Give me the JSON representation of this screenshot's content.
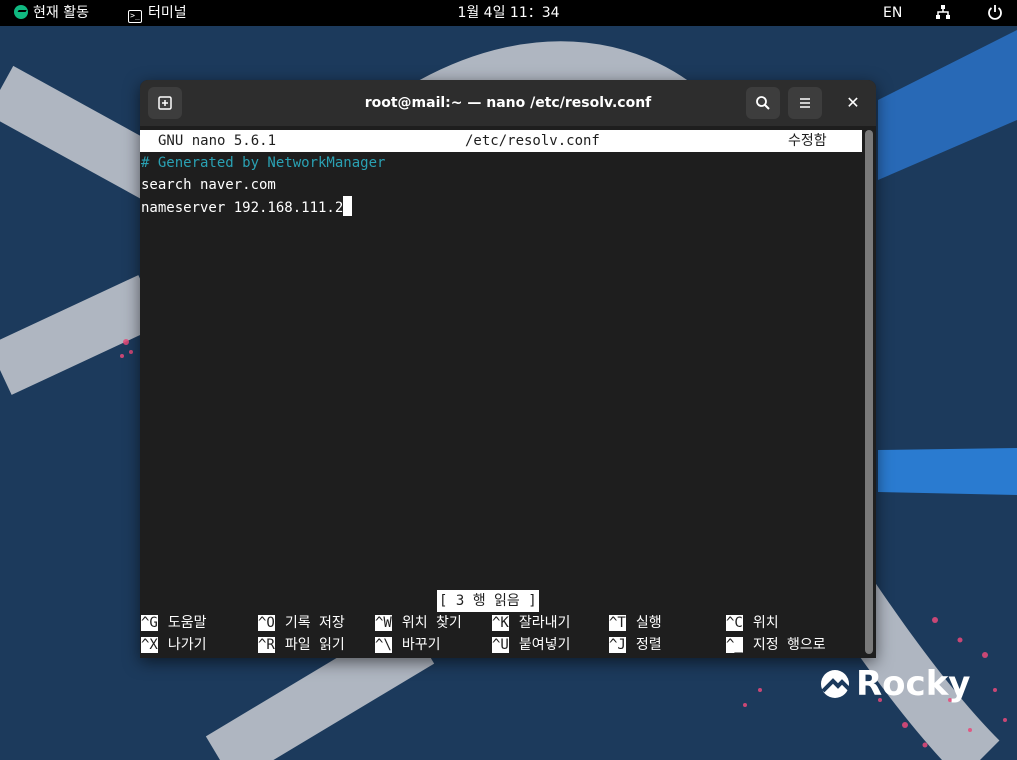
{
  "topbar": {
    "activities": "현재 활동",
    "app_name": "터미널",
    "clock": "1월 4일  11：34",
    "lang": "EN"
  },
  "window": {
    "title": "root@mail:~ — nano /etc/resolv.conf"
  },
  "nano": {
    "version": "GNU nano 5.6.1",
    "filename": "/etc/resolv.conf",
    "modified": "수정함",
    "lines": [
      "# Generated by NetworkManager",
      "search naver.com",
      "nameserver 192.168.111.2"
    ],
    "status": "[ 3 행 읽음 ]",
    "shortcuts_row1": [
      {
        "key": "^G",
        "label": "도움말"
      },
      {
        "key": "^O",
        "label": "기록 저장"
      },
      {
        "key": "^W",
        "label": "위치 찾기"
      },
      {
        "key": "^K",
        "label": "잘라내기"
      },
      {
        "key": "^T",
        "label": "실행"
      },
      {
        "key": "^C",
        "label": "위치"
      }
    ],
    "shortcuts_row2": [
      {
        "key": "^X",
        "label": "나가기"
      },
      {
        "key": "^R",
        "label": "파일 읽기"
      },
      {
        "key": "^\\",
        "label": "바꾸기"
      },
      {
        "key": "^U",
        "label": "붙여넣기"
      },
      {
        "key": "^J",
        "label": "정렬"
      },
      {
        "key": "^_",
        "label": "지정 행으로"
      }
    ]
  },
  "desktop": {
    "logo_text": "Rocky"
  },
  "colors": {
    "desktop_bg": "#1c3a5c",
    "terminal_bg": "#1e1e1e",
    "comment": "#2aa1b3",
    "rocky_green": "#10b981"
  }
}
